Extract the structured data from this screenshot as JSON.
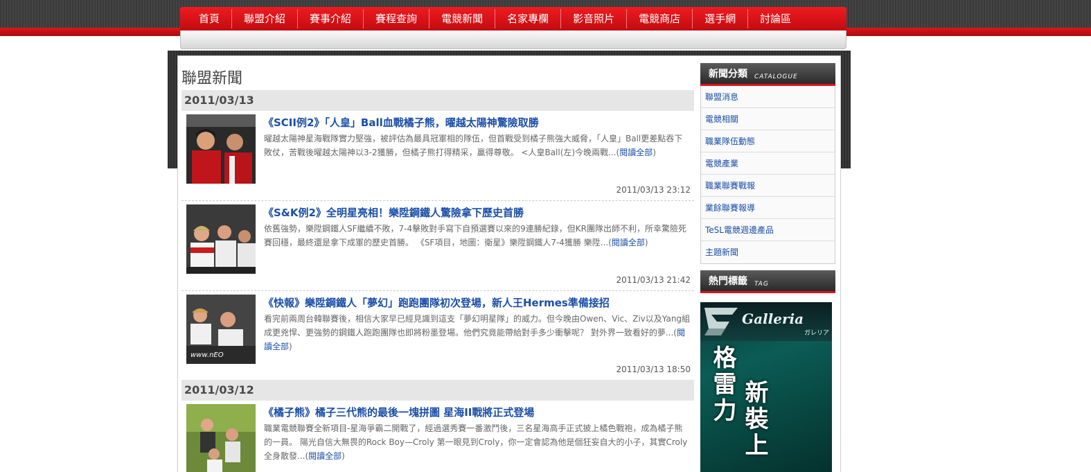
{
  "nav": {
    "items": [
      "首頁",
      "聯盟介紹",
      "賽事介紹",
      "賽程查詢",
      "電競新聞",
      "名家專欄",
      "影音照片",
      "電競商店",
      "選手網",
      "討論區"
    ]
  },
  "main": {
    "section_title": "聯盟新聞",
    "groups": [
      {
        "date": "2011/03/13",
        "articles": [
          {
            "title": "《SCII例2》「人皇」Ball血戰橘子熊，曜越太陽神驚險取勝",
            "body": "曜越太陽神星海戰隊實力堅強，被評估為最具冠軍相的隊伍，但首戰受到橘子熊強大威脅，「人皇」Ball更差點吞下敗仗，苦戰後曜越太陽神以3-2獲勝，但橘子熊打得精采，贏得尊敬。 <人皇Ball(左)今晚兩戰...(",
            "more": "閱讀全部",
            "close": ")",
            "time": "2011/03/13 23:12"
          },
          {
            "title": "《S&K例2》全明星亮相！樂陞鋼鐵人驚險拿下歷史首勝",
            "body": "依舊強勢，樂陞鋼鐵人SF繼續不敗，7-4擊敗對手寫下自預選賽以來的9連勝紀錄，但KR團隊出師不利，所幸驚險死賽回穩，最終還是拿下成軍的歷史首勝。 《SF項目，地圖：衛星》樂陞鋼鐵人7-4獲勝 樂陞...(",
            "more": "閱讀全部",
            "close": ")",
            "time": "2011/03/13 21:42"
          },
          {
            "title": "《快報》樂陞鋼鐵人「夢幻」跑跑團隊初次登場，新人王Hermes準備接招",
            "body": "看完前兩周台韓聯賽後，相信大家早已經見識到這支「夢幻明星隊」的威力。但今晚由Owen、Vic、Ziv以及Yang組成更兇悍、更強勢的鋼鐵人跑跑團隊也即將粉墨登場。他們究竟能帶給對手多少衝擊呢？ 對外界一致看好的夢...(",
            "more": "閱讀全部",
            "close": ")",
            "time": "2011/03/13 18:50"
          }
        ]
      },
      {
        "date": "2011/03/12",
        "articles": [
          {
            "title": "《橘子熊》橘子三代熊的最後一塊拼圖 星海II戰將正式登場",
            "body": "職業電競聯賽全新項目-星海爭霸二開戰了，經過選秀賽一番激鬥後，三名星海高手正式披上橘色戰袍，成為橘子熊的一員。 陽光自信大無畏的Rock Boy—Croly 第一眼見到Croly，你一定會認為他是個狂妄自大的小子，其實Croly全身散發...(",
            "more": "閱讀全部",
            "close": ")",
            "time": ""
          }
        ]
      }
    ]
  },
  "sidebar": {
    "catalogue_title": "新聞分類",
    "catalogue_en": "CATALOGUE",
    "categories": [
      "聯盟消息",
      "電競相關",
      "職業隊伍動態",
      "電競產業",
      "職業聯賽戰報",
      "業餘聯賽報導",
      "TeSL電競週邊產品",
      "主題新聞"
    ],
    "tag_title": "熱門標籤",
    "tag_en": "TAG",
    "banner": {
      "brand": "Galleria",
      "brand_jp": "ガレリア",
      "text_left": "格雷力",
      "text_right": "新裝上"
    }
  },
  "colors": {
    "nav_red": "#e0141a",
    "link_blue": "#1a4ea8",
    "date_bar": "#e6e6e6"
  }
}
